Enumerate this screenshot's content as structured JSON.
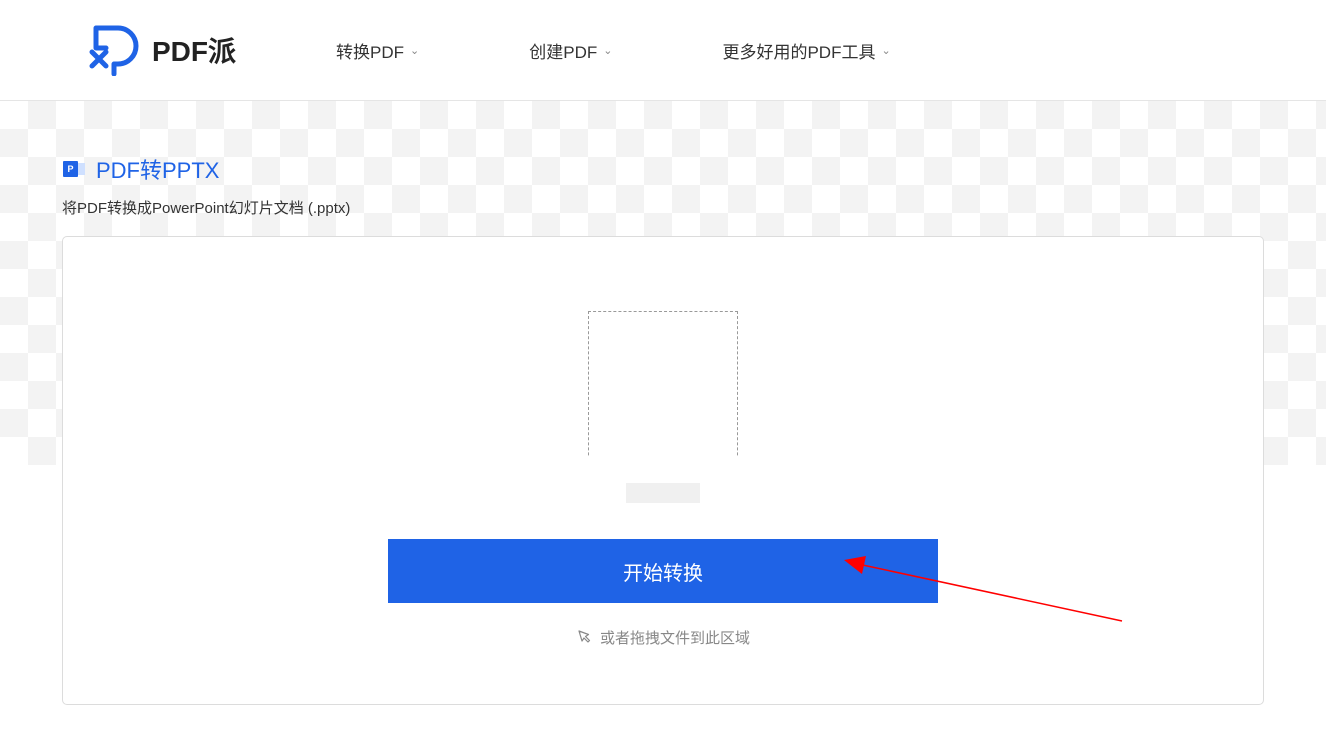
{
  "brand": {
    "name": "PDF派"
  },
  "nav": {
    "items": [
      {
        "label": "转换PDF"
      },
      {
        "label": "创建PDF"
      },
      {
        "label": "更多好用的PDF工具"
      }
    ]
  },
  "page": {
    "title": "PDF转PPTX",
    "subtitle": "将PDF转换成PowerPoint幻灯片文档 (.pptx)"
  },
  "action": {
    "convert_label": "开始转换",
    "drag_hint": "或者拖拽文件到此区域"
  },
  "colors": {
    "primary": "#1f63e6",
    "arrow": "#ff0000"
  }
}
